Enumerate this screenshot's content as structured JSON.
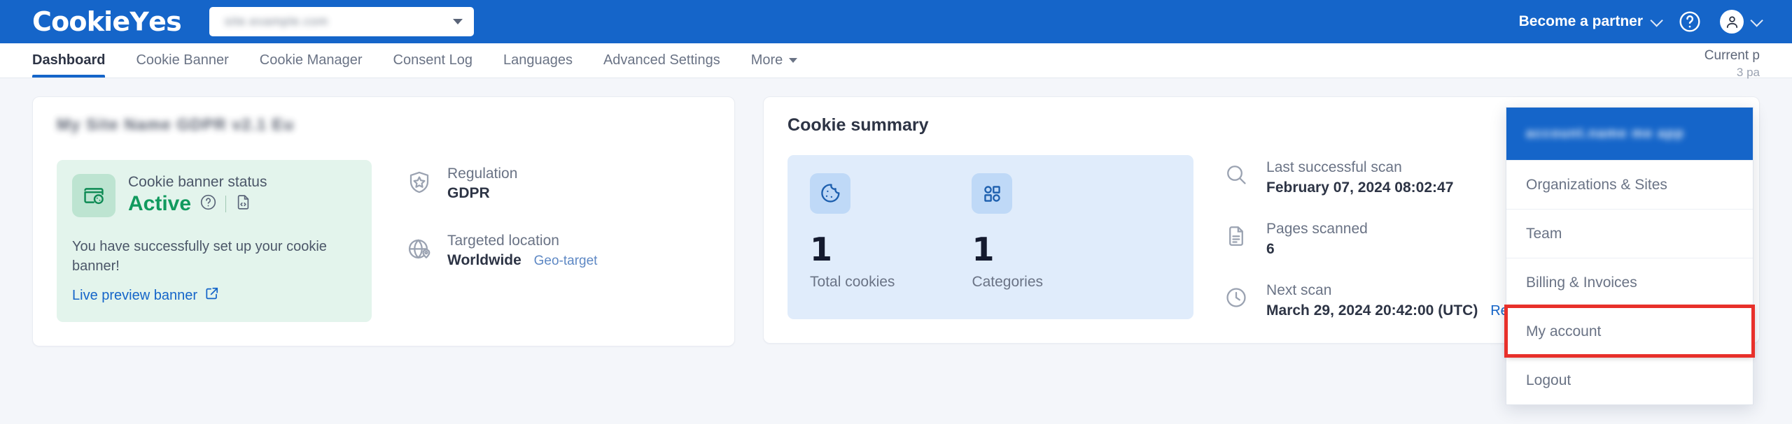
{
  "brand": {
    "name": "CookieYes",
    "primary": "#1565c9",
    "accent_green": "#119a5e",
    "highlight_red": "#e8302a"
  },
  "topbar": {
    "site_selector_value": "",
    "partner_label": "Become a partner",
    "help_icon": "question-circle-icon",
    "avatar_icon": "user-avatar-icon"
  },
  "tabs": [
    {
      "label": "Dashboard",
      "active": true
    },
    {
      "label": "Cookie Banner",
      "active": false
    },
    {
      "label": "Cookie Manager",
      "active": false
    },
    {
      "label": "Consent Log",
      "active": false
    },
    {
      "label": "Languages",
      "active": false
    },
    {
      "label": "Advanced Settings",
      "active": false
    },
    {
      "label": "More",
      "active": false,
      "caret": true
    }
  ],
  "plan": {
    "line1_prefix": "Current p",
    "line2": "3 pa"
  },
  "left_card": {
    "site_name": "",
    "status": {
      "label": "Cookie banner status",
      "value": "Active",
      "help_icon": "question-circle-icon",
      "script_icon": "code-file-icon",
      "message": "You have successfully set up your cookie banner!",
      "link_label": "Live preview banner",
      "link_icon": "external-link-icon"
    },
    "info": [
      {
        "icon": "shield-star-icon",
        "label": "Regulation",
        "value": "GDPR",
        "sub": ""
      },
      {
        "icon": "globe-pin-icon",
        "label": "Targeted location",
        "value": "Worldwide",
        "sub": "Geo-target"
      }
    ]
  },
  "right_card": {
    "title": "Cookie summary",
    "stats": [
      {
        "icon": "cookie-icon",
        "number": "1",
        "caption": "Total cookies"
      },
      {
        "icon": "categories-grid-icon",
        "number": "1",
        "caption": "Categories"
      }
    ],
    "scans": [
      {
        "icon": "magnifier-icon",
        "label": "Last successful scan",
        "value": "February 07, 2024 08:02:47",
        "action": ""
      },
      {
        "icon": "document-lines-icon",
        "label": "Pages scanned",
        "value": "6",
        "action": ""
      },
      {
        "icon": "clock-icon",
        "label": "Next scan",
        "value": "March 29, 2024 20:42:00 (UTC)",
        "action": "Reschedule"
      }
    ]
  },
  "account_menu": {
    "header_value": "",
    "items": [
      {
        "label": "Organizations & Sites",
        "highlighted": false
      },
      {
        "label": "Team",
        "highlighted": false
      },
      {
        "label": "Billing & Invoices",
        "highlighted": false
      },
      {
        "label": "My account",
        "highlighted": true
      },
      {
        "label": "Logout",
        "highlighted": false
      }
    ]
  }
}
